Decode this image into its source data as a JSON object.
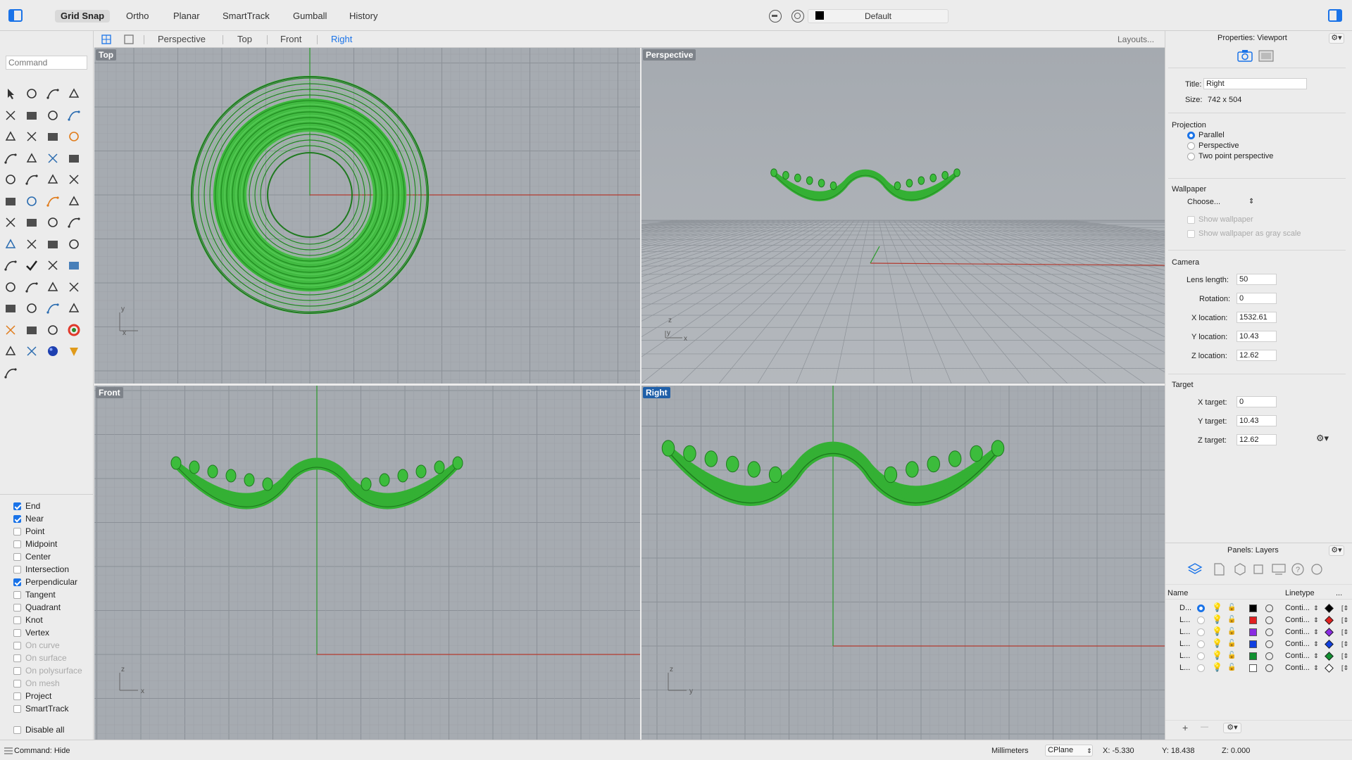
{
  "toolbar": {
    "modes": [
      "Grid Snap",
      "Ortho",
      "Planar",
      "SmartTrack",
      "Gumball",
      "History"
    ],
    "active_mode": "Grid Snap",
    "layer_name": "Default",
    "layer_color": "#000000"
  },
  "view_tabs": {
    "tabs": [
      "Perspective",
      "Top",
      "Front",
      "Right"
    ],
    "active": "Right",
    "layouts_label": "Layouts..."
  },
  "command": {
    "placeholder": "Command"
  },
  "osnaps": [
    {
      "label": "End",
      "checked": true,
      "enabled": true
    },
    {
      "label": "Near",
      "checked": true,
      "enabled": true
    },
    {
      "label": "Point",
      "checked": false,
      "enabled": true
    },
    {
      "label": "Midpoint",
      "checked": false,
      "enabled": true
    },
    {
      "label": "Center",
      "checked": false,
      "enabled": true
    },
    {
      "label": "Intersection",
      "checked": false,
      "enabled": true
    },
    {
      "label": "Perpendicular",
      "checked": true,
      "enabled": true
    },
    {
      "label": "Tangent",
      "checked": false,
      "enabled": true
    },
    {
      "label": "Quadrant",
      "checked": false,
      "enabled": true
    },
    {
      "label": "Knot",
      "checked": false,
      "enabled": true
    },
    {
      "label": "Vertex",
      "checked": false,
      "enabled": true
    },
    {
      "label": "On curve",
      "checked": false,
      "enabled": false
    },
    {
      "label": "On surface",
      "checked": false,
      "enabled": false
    },
    {
      "label": "On polysurface",
      "checked": false,
      "enabled": false
    },
    {
      "label": "On mesh",
      "checked": false,
      "enabled": false
    },
    {
      "label": "Project",
      "checked": false,
      "enabled": true
    },
    {
      "label": "SmartTrack",
      "checked": false,
      "enabled": true
    },
    {
      "label": "Disable all",
      "checked": false,
      "enabled": true
    }
  ],
  "viewports": {
    "top": "Top",
    "perspective": "Perspective",
    "front": "Front",
    "right": "Right",
    "active": "Right"
  },
  "properties": {
    "title": "Properties: Viewport",
    "title_label": "Title:",
    "title_value": "Right",
    "size_label": "Size:",
    "size_value": "742 x 504",
    "projection_head": "Projection",
    "projections": [
      "Parallel",
      "Perspective",
      "Two point perspective"
    ],
    "projection_selected": "Parallel",
    "wallpaper_head": "Wallpaper",
    "wallpaper_choose": "Choose...",
    "show_wallpaper": "Show wallpaper",
    "show_wallpaper_gray": "Show wallpaper as gray scale",
    "camera_head": "Camera",
    "lens_label": "Lens length:",
    "lens_value": "50",
    "rotation_label": "Rotation:",
    "rotation_value": "0",
    "xloc_label": "X location:",
    "xloc_value": "1532.61",
    "yloc_label": "Y location:",
    "yloc_value": "10.43",
    "zloc_label": "Z location:",
    "zloc_value": "12.62",
    "target_head": "Target",
    "xt_label": "X target:",
    "xt_value": "0",
    "yt_label": "Y target:",
    "yt_value": "10.43",
    "zt_label": "Z target:",
    "zt_value": "12.62"
  },
  "layers_panel": {
    "title": "Panels: Layers",
    "col_name": "Name",
    "col_linetype": "Linetype",
    "col_more": "...",
    "rows": [
      {
        "name": "D...",
        "color": "#000000",
        "linetype": "Conti...",
        "current": true
      },
      {
        "name": "L...",
        "color": "#e02020",
        "linetype": "Conti...",
        "current": false
      },
      {
        "name": "L...",
        "color": "#8a2be2",
        "linetype": "Conti...",
        "current": false
      },
      {
        "name": "L...",
        "color": "#1040e0",
        "linetype": "Conti...",
        "current": false
      },
      {
        "name": "L...",
        "color": "#109030",
        "linetype": "Conti...",
        "current": false
      },
      {
        "name": "L...",
        "color": "#ffffff",
        "linetype": "Conti...",
        "current": false
      }
    ],
    "add_label": "+",
    "remove_label": "—"
  },
  "statusbar": {
    "command_text": "Command: Hide",
    "units": "Millimeters",
    "cplane": "CPlane",
    "x": "X: -5.330",
    "y": "Y: 18.438",
    "z": "Z: 0.000"
  }
}
